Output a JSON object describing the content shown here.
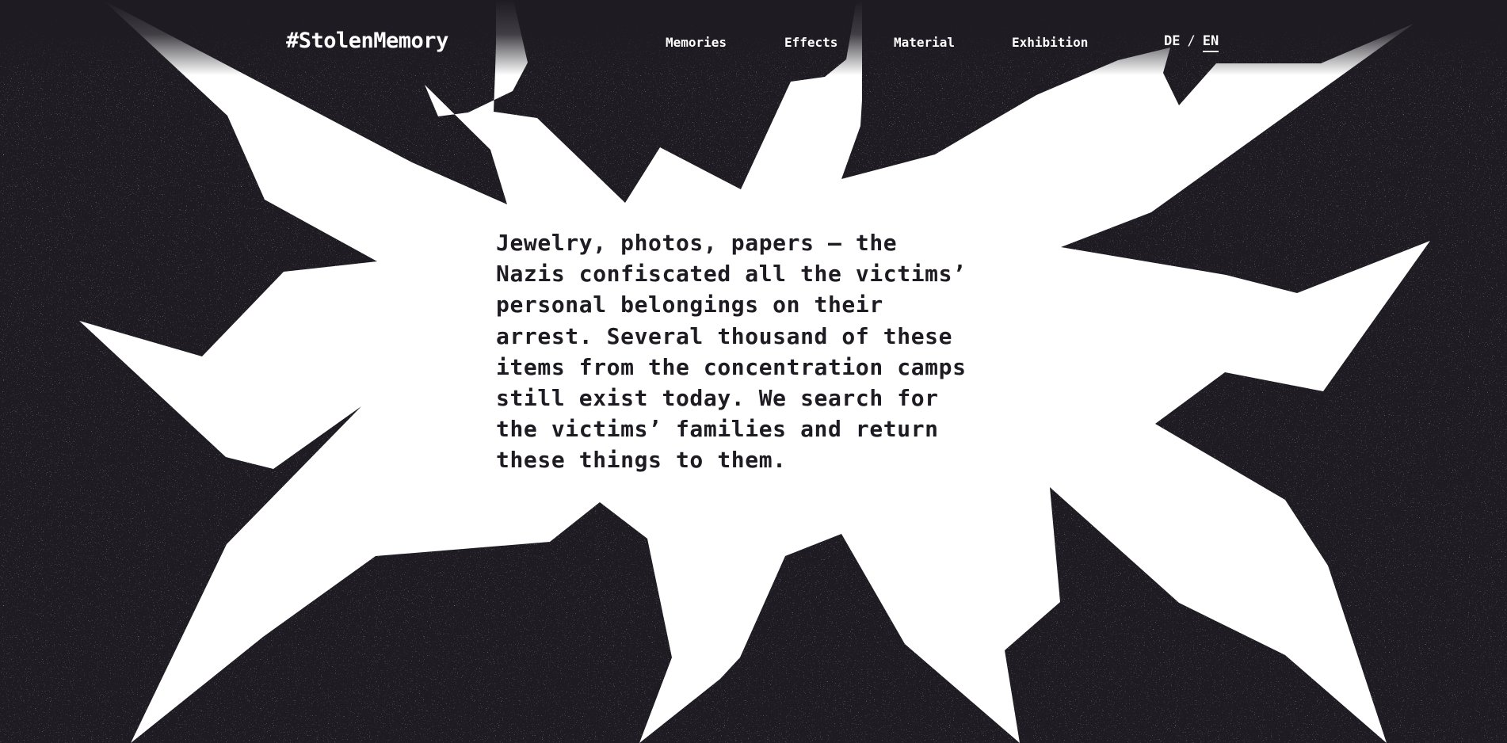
{
  "brand": {
    "logo": "#StolenMemory"
  },
  "nav": {
    "items": [
      {
        "label": "Memories"
      },
      {
        "label": "Effects"
      },
      {
        "label": "Material"
      },
      {
        "label": "Exhibition"
      }
    ]
  },
  "language": {
    "de": "DE",
    "separator": "/",
    "en": "EN",
    "active": "EN"
  },
  "hero": {
    "text": "Jewelry, photos, papers – the\nNazis confiscated all the victims’\npersonal belongings on their\narrest. Several thousand of these\nitems from the concentration camps\nstill exist today. We search for\nthe victims’ families and return\nthese things to them."
  },
  "colors": {
    "background": "#1e1b22",
    "shape": "#ffffff",
    "text_light": "#ffffff",
    "text_dark": "#1e1b22"
  }
}
